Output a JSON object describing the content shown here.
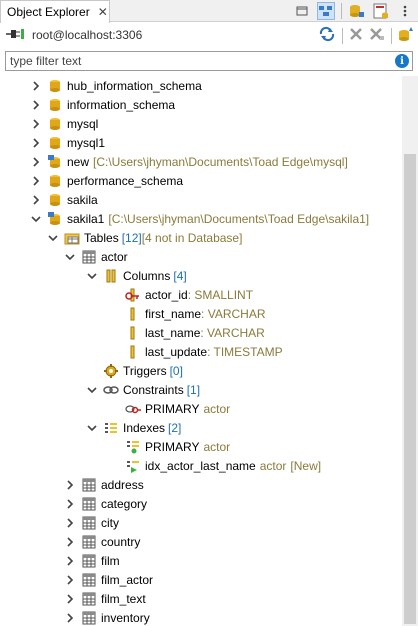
{
  "tab": {
    "title": "Object Explorer",
    "close": "✕"
  },
  "connection": {
    "label": "root@localhost:3306"
  },
  "filter": {
    "placeholder": "type filter text"
  },
  "tree": {
    "hub": "hub_information_schema",
    "info": "information_schema",
    "mysql": "mysql",
    "mysql1": "mysql1",
    "new": "new",
    "new_path": "[C:\\Users\\jhyman\\Documents\\Toad Edge\\mysql]",
    "perf": "performance_schema",
    "sakila": "sakila",
    "sakila1": "sakila1",
    "sakila1_path": "[C:\\Users\\jhyman\\Documents\\Toad Edge\\sakila1]",
    "tables": "Tables",
    "tables_count": "[12]",
    "tables_note": "[4 not in Database]",
    "actor": "actor",
    "columns": "Columns",
    "columns_count": "[4]",
    "col1": "actor_id",
    "col1_type": ": SMALLINT",
    "col2": "first_name",
    "col2_type": ": VARCHAR",
    "col3": "last_name",
    "col3_type": ": VARCHAR",
    "col4": "last_update",
    "col4_type": ": TIMESTAMP",
    "triggers": "Triggers",
    "triggers_count": "[0]",
    "constraints": "Constraints",
    "constraints_count": "[1]",
    "primary": "PRIMARY",
    "primary_table": "actor",
    "indexes": "Indexes",
    "indexes_count": "[2]",
    "idx_primary": "PRIMARY",
    "idx_primary_table": "actor",
    "idx_last": "idx_actor_last_name",
    "idx_last_table": "actor",
    "idx_last_new": "[New]",
    "address": "address",
    "category": "category",
    "city": "city",
    "country": "country",
    "film": "film",
    "film_actor": "film_actor",
    "film_text": "film_text",
    "inventory": "inventory"
  },
  "colors": {
    "accent": "#1f6fb3",
    "path": "#8a7a3a",
    "db": "#e0b020"
  }
}
